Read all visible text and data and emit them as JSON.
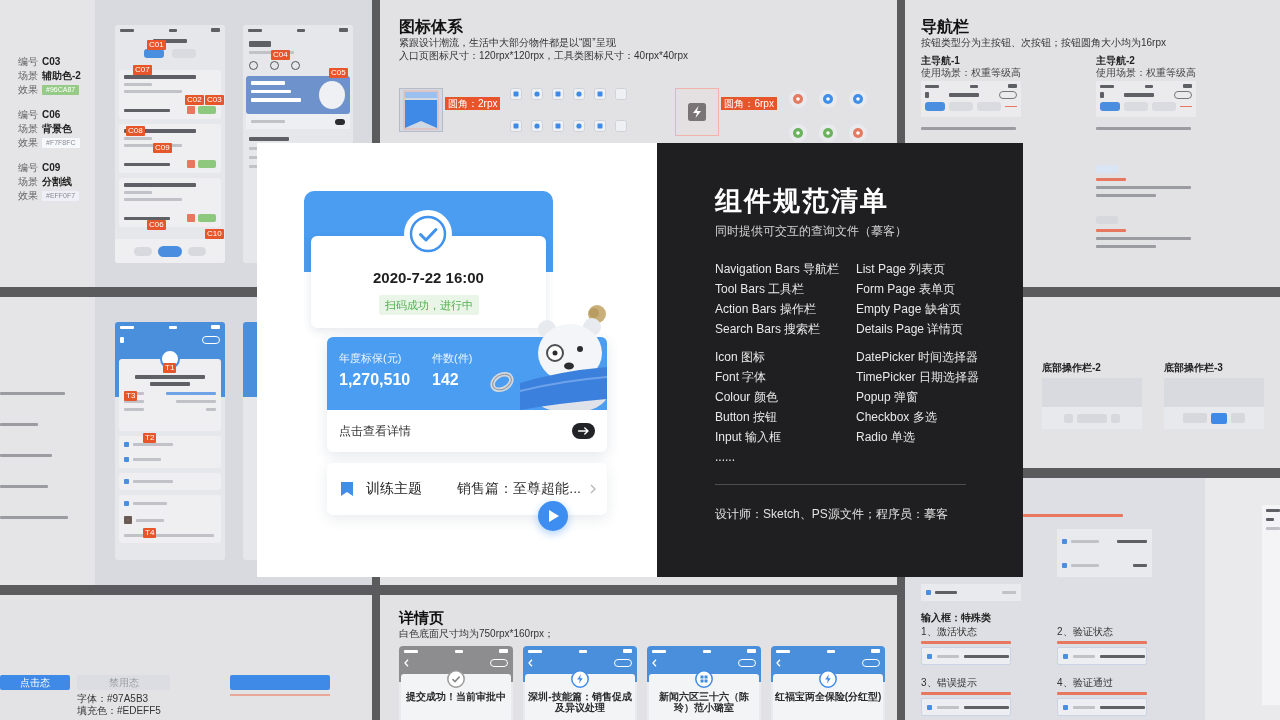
{
  "boards": {
    "color_specs": [
      {
        "code_label": "编号",
        "code": "C03",
        "scene_label": "场景",
        "scene": "辅助色-2",
        "effect_label": "效果",
        "effect": "#96CA87",
        "color": "#96ca87"
      },
      {
        "code_label": "编号",
        "code": "C06",
        "scene_label": "场景",
        "scene": "背景色",
        "effect_label": "效果",
        "effect": "#F7F8FC",
        "color": "#f7f8fc"
      },
      {
        "code_label": "编号",
        "code": "C09",
        "scene_label": "场景",
        "scene": "分割线",
        "effect_label": "效果",
        "effect": "#EFF0F7",
        "color": "#eff0f7"
      }
    ],
    "list_phone_tags": [
      "C01",
      "C07",
      "C02",
      "C03",
      "C08",
      "C09",
      "C06",
      "C10"
    ],
    "profile_phone_tags": [
      "C04",
      "C05"
    ],
    "detail_phone_tags": [
      "T1",
      "T3",
      "T2",
      "T4"
    ],
    "button_states": {
      "buttons": [
        {
          "label": "点击态",
          "kind": "primary"
        },
        {
          "label": "禁用态",
          "kind": "disabled"
        }
      ],
      "specs": [
        "字体：#97A5B3",
        "填充色：#EDEFF5"
      ]
    },
    "icon_system": {
      "title": "图标体系",
      "lines": [
        "紧跟设计潮流，生活中大部分物件都是以“圆”呈现",
        "入口页图标尺寸：120rpx*120rpx，工具类图标尺寸：40rpx*40rpx"
      ],
      "tags": [
        "圆角：2rpx",
        "圆角：6rpx"
      ]
    },
    "navigation_bars": {
      "title": "导航栏",
      "subtitle": "按钮类型分为主按钮、次按钮；按钮圆角大小均为16rpx",
      "variants": [
        {
          "name": "主导航-1",
          "usage": "使用场景：权重等级高"
        },
        {
          "name": "主导航-2",
          "usage": "使用场景：权重等级高"
        }
      ]
    },
    "action_bars": {
      "variants": [
        {
          "name": "底部操作栏-2",
          "kind": "pager"
        },
        {
          "name": "底部操作栏-3",
          "kind": "buttons"
        }
      ]
    },
    "detail_pages": {
      "title": "详情页",
      "subtitle": "白色底面尺寸均为750rpx*160rpx；",
      "pages": [
        {
          "title": "提交成功！当前审批中",
          "kind": "annotated"
        },
        {
          "title": "深圳-技能篇：销售促成及异议处理",
          "kind": "plain"
        },
        {
          "title": "新闻六区三十六（陈玲）范小璐室",
          "kind": "plain"
        },
        {
          "title": "红福宝两全保险(分红型)",
          "kind": "plain"
        }
      ]
    },
    "input_special": {
      "title": "输入框：特殊类",
      "states": [
        "1、激活状态",
        "2、验证状态",
        "3、错误提示",
        "4、验证通过"
      ]
    }
  },
  "showcase": {
    "checkin_card": {
      "datetime": "2020-7-22 16:00",
      "status": "扫码成功，进行中"
    },
    "target_card": {
      "stats": [
        {
          "label": "年度标保(元)",
          "value": "1,270,510"
        },
        {
          "label": "件数(件)",
          "value": "142"
        }
      ],
      "link": "点击查看详情"
    },
    "topic_row": {
      "label": "训练主题",
      "value": "销售篇：至尊超能..."
    }
  },
  "catalog": {
    "title": "组件规范清单",
    "subtitle": "同时提供可交互的查询文件（摹客）",
    "groups": [
      {
        "column_1": [
          "Navigation Bars 导航栏",
          "Tool Bars 工具栏",
          "Action Bars 操作栏",
          "Search Bars 搜索栏"
        ],
        "column_2": [
          "List Page 列表页",
          "Form Page 表单页",
          "Empty Page 缺省页",
          "Details Page 详情页"
        ]
      },
      {
        "column_1": [
          "Icon 图标",
          "Font 字体",
          "Colour 颜色",
          "Button 按钮",
          "Input 输入框",
          "......"
        ],
        "column_2": [
          "DatePicker 时间选择器",
          "TimePicker 日期选择器",
          "Popup 弹窗",
          "Checkbox 多选",
          "Radio 单选"
        ]
      }
    ],
    "footer": "设计师：Sketch、PS源文件；程序员：摹客"
  }
}
